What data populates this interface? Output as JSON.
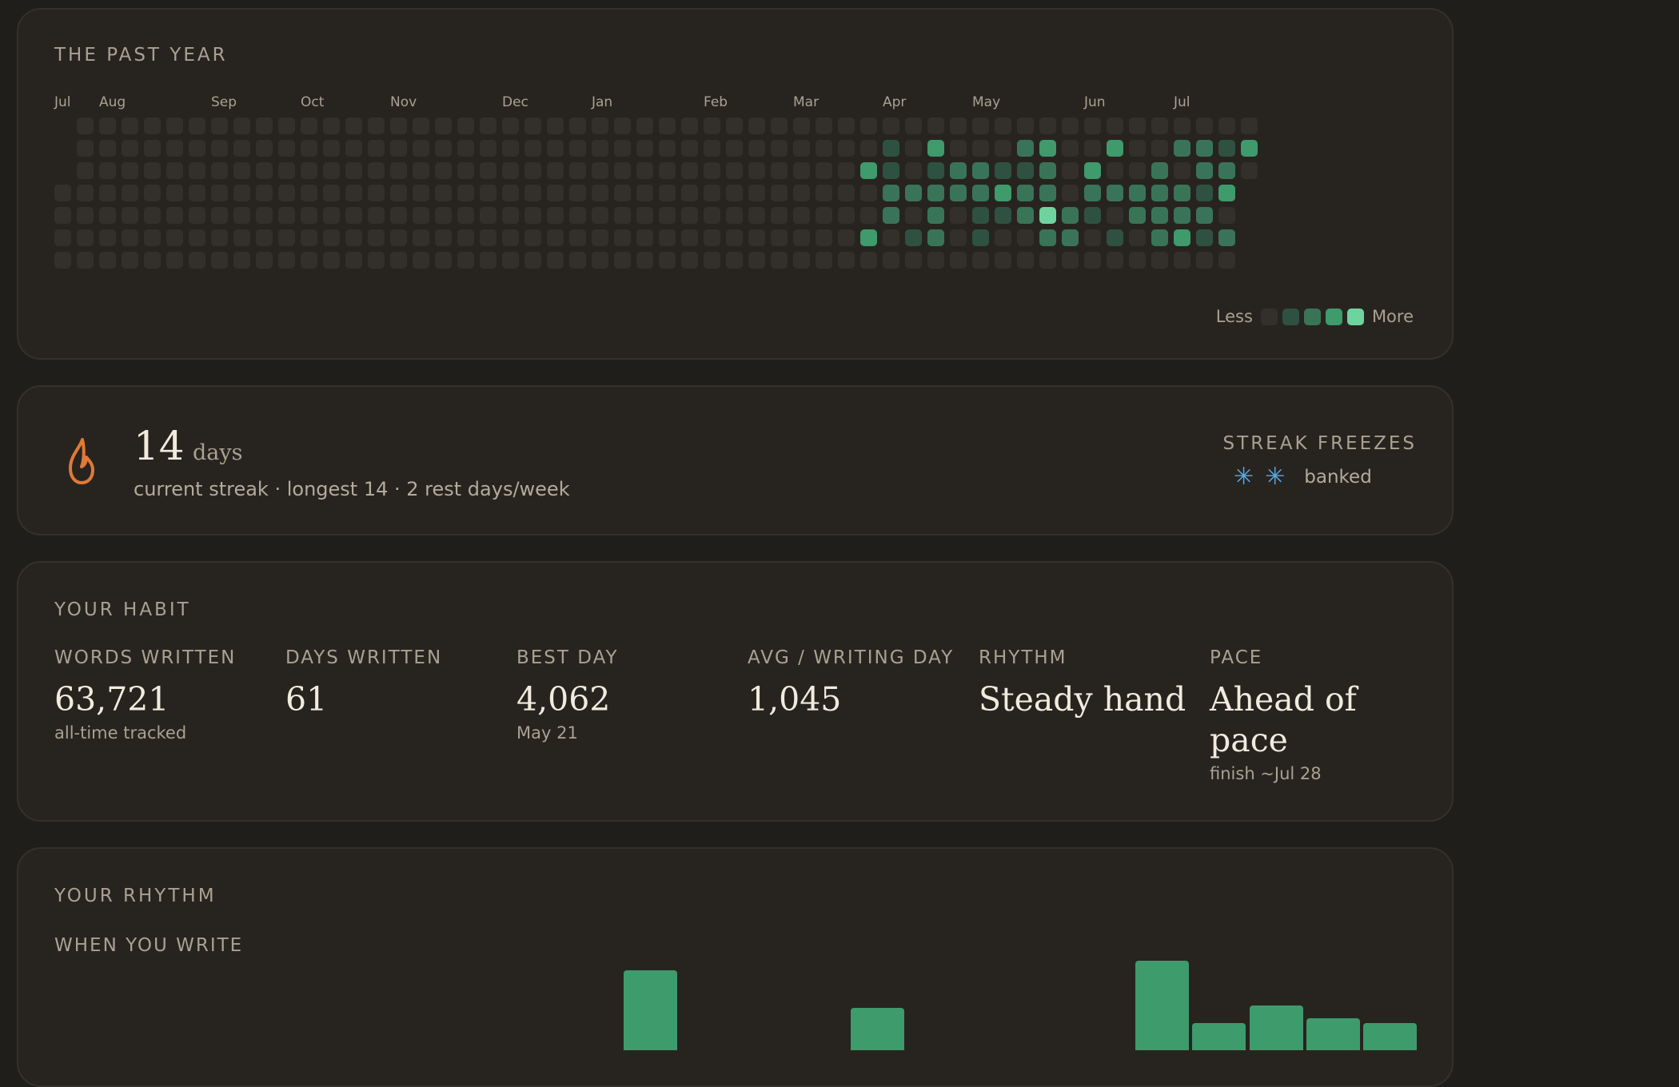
{
  "year": {
    "title": "THE PAST YEAR",
    "months": [
      "Jul",
      "Aug",
      "Sep",
      "Oct",
      "Nov",
      "Dec",
      "Jan",
      "Feb",
      "Mar",
      "Apr",
      "May",
      "Jun",
      "Jul"
    ],
    "month_week_index": [
      0,
      2,
      7,
      11,
      15,
      20,
      24,
      29,
      33,
      37,
      41,
      46,
      50
    ],
    "week_count": 54,
    "levels_by_week": [
      [
        null,
        null,
        null,
        0,
        0,
        0,
        0
      ],
      [
        0,
        0,
        0,
        0,
        0,
        0,
        0
      ],
      [
        0,
        0,
        0,
        0,
        0,
        0,
        0
      ],
      [
        0,
        0,
        0,
        0,
        0,
        0,
        0
      ],
      [
        0,
        0,
        0,
        0,
        0,
        0,
        0
      ],
      [
        0,
        0,
        0,
        0,
        0,
        0,
        0
      ],
      [
        0,
        0,
        0,
        0,
        0,
        0,
        0
      ],
      [
        0,
        0,
        0,
        0,
        0,
        0,
        0
      ],
      [
        0,
        0,
        0,
        0,
        0,
        0,
        0
      ],
      [
        0,
        0,
        0,
        0,
        0,
        0,
        0
      ],
      [
        0,
        0,
        0,
        0,
        0,
        0,
        0
      ],
      [
        0,
        0,
        0,
        0,
        0,
        0,
        0
      ],
      [
        0,
        0,
        0,
        0,
        0,
        0,
        0
      ],
      [
        0,
        0,
        0,
        0,
        0,
        0,
        0
      ],
      [
        0,
        0,
        0,
        0,
        0,
        0,
        0
      ],
      [
        0,
        0,
        0,
        0,
        0,
        0,
        0
      ],
      [
        0,
        0,
        0,
        0,
        0,
        0,
        0
      ],
      [
        0,
        0,
        0,
        0,
        0,
        0,
        0
      ],
      [
        0,
        0,
        0,
        0,
        0,
        0,
        0
      ],
      [
        0,
        0,
        0,
        0,
        0,
        0,
        0
      ],
      [
        0,
        0,
        0,
        0,
        0,
        0,
        0
      ],
      [
        0,
        0,
        0,
        0,
        0,
        0,
        0
      ],
      [
        0,
        0,
        0,
        0,
        0,
        0,
        0
      ],
      [
        0,
        0,
        0,
        0,
        0,
        0,
        0
      ],
      [
        0,
        0,
        0,
        0,
        0,
        0,
        0
      ],
      [
        0,
        0,
        0,
        0,
        0,
        0,
        0
      ],
      [
        0,
        0,
        0,
        0,
        0,
        0,
        0
      ],
      [
        0,
        0,
        0,
        0,
        0,
        0,
        0
      ],
      [
        0,
        0,
        0,
        0,
        0,
        0,
        0
      ],
      [
        0,
        0,
        0,
        0,
        0,
        0,
        0
      ],
      [
        0,
        0,
        0,
        0,
        0,
        0,
        0
      ],
      [
        0,
        0,
        0,
        0,
        0,
        0,
        0
      ],
      [
        0,
        0,
        0,
        0,
        0,
        0,
        0
      ],
      [
        0,
        0,
        0,
        0,
        0,
        0,
        0
      ],
      [
        0,
        0,
        0,
        0,
        0,
        0,
        0
      ],
      [
        0,
        0,
        0,
        0,
        0,
        0,
        0
      ],
      [
        0,
        0,
        3,
        0,
        0,
        3,
        0
      ],
      [
        0,
        1,
        1,
        2,
        2,
        0,
        0
      ],
      [
        0,
        0,
        0,
        2,
        0,
        1,
        0
      ],
      [
        0,
        3,
        1,
        2,
        2,
        2,
        0
      ],
      [
        0,
        0,
        2,
        2,
        0,
        0,
        0
      ],
      [
        0,
        0,
        2,
        2,
        1,
        1,
        0
      ],
      [
        0,
        0,
        1,
        3,
        1,
        0,
        0
      ],
      [
        0,
        2,
        1,
        2,
        2,
        0,
        0
      ],
      [
        0,
        3,
        2,
        2,
        4,
        2,
        0
      ],
      [
        0,
        0,
        0,
        0,
        2,
        2,
        0
      ],
      [
        0,
        0,
        3,
        2,
        1,
        0,
        0
      ],
      [
        0,
        3,
        0,
        2,
        0,
        1,
        0
      ],
      [
        0,
        0,
        0,
        2,
        2,
        0,
        0
      ],
      [
        0,
        0,
        2,
        2,
        2,
        2,
        0
      ],
      [
        0,
        2,
        0,
        2,
        2,
        3,
        0
      ],
      [
        0,
        2,
        2,
        1,
        2,
        1,
        0
      ],
      [
        0,
        1,
        2,
        3,
        0,
        2,
        0
      ],
      [
        0,
        3,
        0,
        null,
        null,
        null,
        null
      ]
    ],
    "level_colors": [
      "#332f2a",
      "#2f5141",
      "#3a7458",
      "#3f9a6c",
      "#6fd3a0"
    ],
    "legend_less": "Less",
    "legend_more": "More"
  },
  "streak": {
    "value": "14",
    "unit": "days",
    "subtitle": "current streak · longest 14 · 2 rest days/week",
    "icon": "flame-icon",
    "freezes_title": "STREAK FREEZES",
    "freezes_count": 2,
    "freezes_label": "banked"
  },
  "habit": {
    "title": "YOUR HABIT",
    "stats": [
      {
        "label": "WORDS WRITTEN",
        "value": "63,721",
        "sub": "all-time tracked"
      },
      {
        "label": "DAYS WRITTEN",
        "value": "61",
        "sub": ""
      },
      {
        "label": "BEST DAY",
        "value": "4,062",
        "sub": "May 21"
      },
      {
        "label": "AVG / WRITING DAY",
        "value": "1,045",
        "sub": ""
      },
      {
        "label": "RHYTHM",
        "value": "Steady hand",
        "sub": ""
      },
      {
        "label": "PACE",
        "value": "Ahead of pace",
        "sub": "finish ~Jul 28"
      }
    ]
  },
  "rhythm": {
    "title": "YOUR RHYTHM",
    "subtitle": "WHEN YOU WRITE",
    "chart_data": {
      "type": "bar",
      "values": [
        0,
        0,
        0,
        0,
        0,
        0,
        0,
        0,
        0,
        0,
        0.89,
        0,
        0,
        0,
        0.47,
        0,
        0,
        0,
        0,
        1.0,
        0.3,
        0.5,
        0.36,
        0.3
      ],
      "color": "#3e9b6c"
    }
  }
}
